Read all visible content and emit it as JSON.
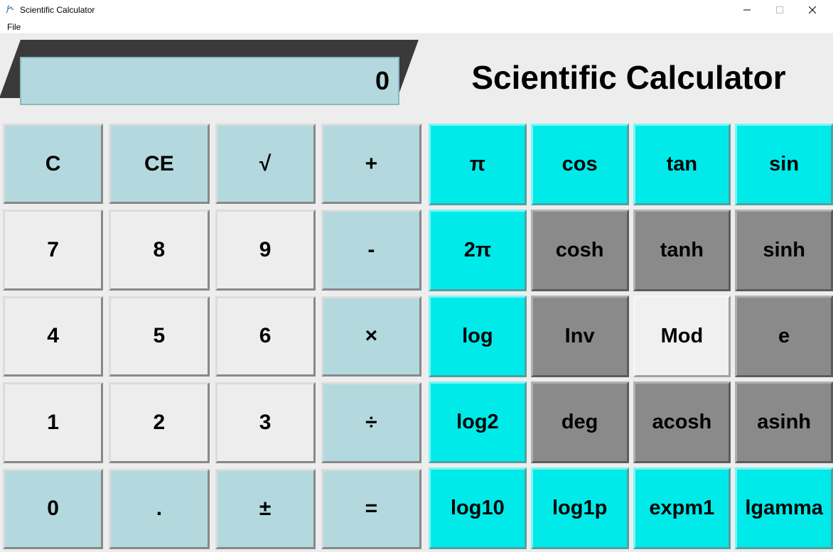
{
  "window": {
    "title": "Scientific Calculator"
  },
  "menubar": {
    "file": "File"
  },
  "display": {
    "value": "0"
  },
  "heading": "Scientific Calculator",
  "left": {
    "r0": {
      "c": "C",
      "ce": "CE",
      "sqrt": "√",
      "plus": "+"
    },
    "r1": {
      "n7": "7",
      "n8": "8",
      "n9": "9",
      "minus": "-"
    },
    "r2": {
      "n4": "4",
      "n5": "5",
      "n6": "6",
      "times": "×"
    },
    "r3": {
      "n1": "1",
      "n2": "2",
      "n3": "3",
      "div": "÷"
    },
    "r4": {
      "n0": "0",
      "dot": ".",
      "pm": "±",
      "eq": "="
    }
  },
  "right": {
    "r0": {
      "pi": "π",
      "cos": "cos",
      "tan": "tan",
      "sin": "sin"
    },
    "r1": {
      "tau": "2π",
      "cosh": "cosh",
      "tanh": "tanh",
      "sinh": "sinh"
    },
    "r2": {
      "log": "log",
      "inv": "Inv",
      "mod": "Mod",
      "e": "e"
    },
    "r3": {
      "log2": "log2",
      "deg": "deg",
      "acosh": "acosh",
      "asinh": "asinh"
    },
    "r4": {
      "log10": "log10",
      "log1p": "log1p",
      "expm1": "expm1",
      "lgamma": "lgamma"
    }
  }
}
